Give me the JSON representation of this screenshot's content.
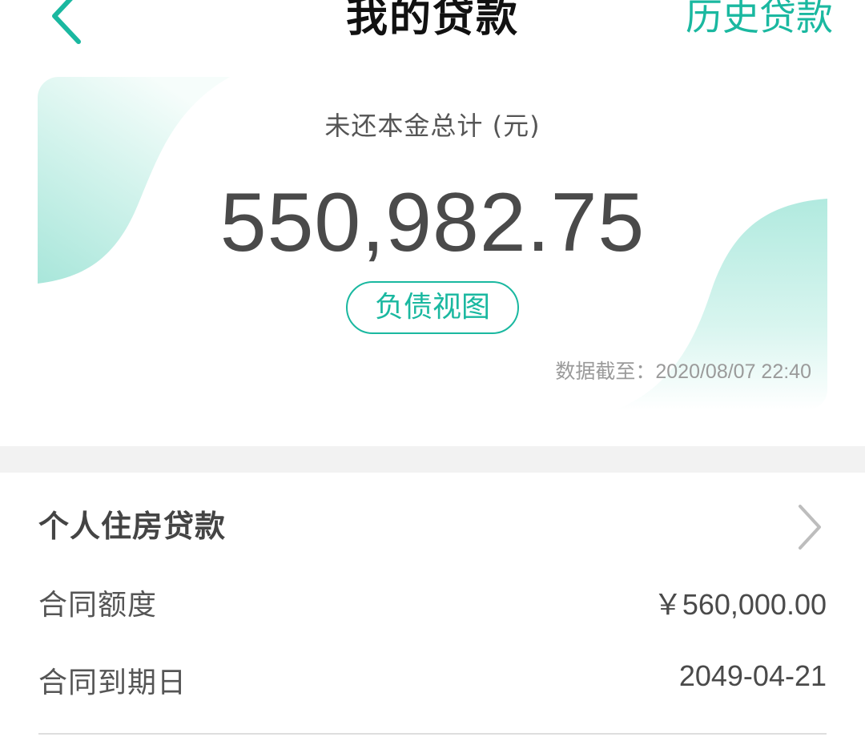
{
  "header": {
    "back_icon": "chevron-left-icon",
    "title": "我的贷款",
    "history_label": "历史贷款"
  },
  "summary": {
    "label": "未还本金总计 (元)",
    "amount": "550,982.75",
    "debt_view_label": "负债视图",
    "data_time": "数据截至：2020/08/07 22:40"
  },
  "loan": {
    "title": "个人住房贷款",
    "arrow_icon": "chevron-right-icon",
    "rows": [
      {
        "label": "合同额度",
        "value": "￥560,000.00"
      },
      {
        "label": "合同到期日",
        "value": "2049-04-21"
      }
    ]
  },
  "colors": {
    "accent": "#1ab8a0",
    "wave": "#b8ece2",
    "separator": "#f2f2f2"
  }
}
